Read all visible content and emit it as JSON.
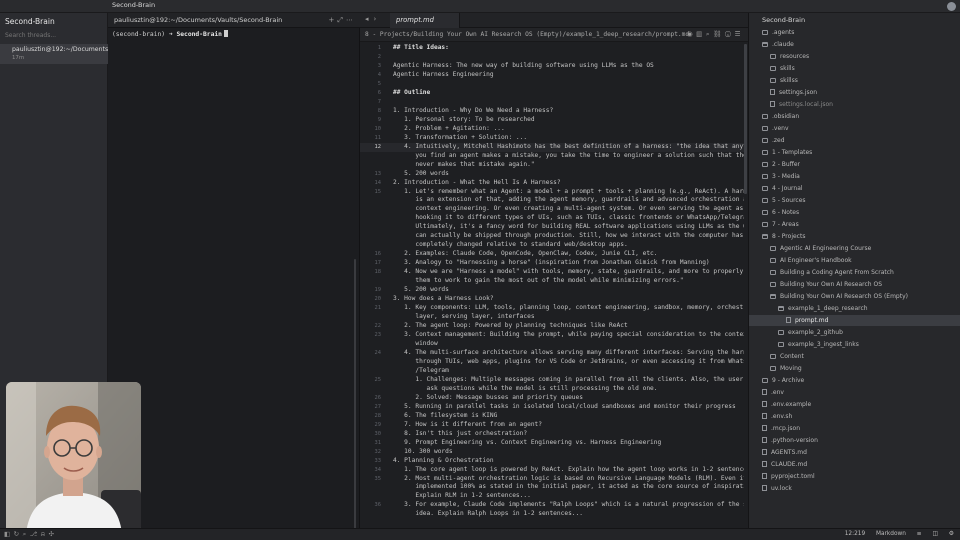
{
  "app": {
    "title": "Second-Brain"
  },
  "left_sidebar": {
    "vault_title": "Second-Brain",
    "search_placeholder": "Search threads...",
    "threads": [
      {
        "title": "pauliusztin@192:~/Documents/Vaults/Second-Brain",
        "time": "17m"
      }
    ]
  },
  "terminal": {
    "tab_title": "pauliusztin@192:~/Documents/Vaults/Second-Brain",
    "prompt_env": "(second-brain)",
    "prompt_arrow": "➜",
    "prompt_dir": "Second-Brain"
  },
  "editor": {
    "tab_label": "prompt.md",
    "path": "8 - Projects/Building Your Own AI Research OS (Empty)/example_1_deep_research/prompt.md",
    "active_line": "12",
    "lines": [
      {
        "n": "1",
        "t": "## Title Ideas:",
        "h": true
      },
      {
        "n": "2",
        "t": ""
      },
      {
        "n": "3",
        "t": "Agentic Harness: The new way of building software using LLMs as the OS"
      },
      {
        "n": "4",
        "t": "Agentic Harness Engineering"
      },
      {
        "n": "5",
        "t": ""
      },
      {
        "n": "6",
        "t": "## Outline",
        "h": true
      },
      {
        "n": "7",
        "t": ""
      },
      {
        "n": "8",
        "t": "1. Introduction - Why Do We Need a Harness?"
      },
      {
        "n": "9",
        "t": "   1. Personal story: To be researched"
      },
      {
        "n": "10",
        "t": "   2. Problem + Agitation: ..."
      },
      {
        "n": "11",
        "t": "   3. Transformation + Solution: ..."
      },
      {
        "n": "12",
        "t": "   4. Intuitively, Mitchell Hashimoto has the best definition of a harness: \"the idea that anytime"
      },
      {
        "n": "",
        "t": "      you find an agent makes a mistake, you take the time to engineer a solution such that the agent"
      },
      {
        "n": "",
        "t": "      never makes that mistake again.\""
      },
      {
        "n": "13",
        "t": "   5. 200 words"
      },
      {
        "n": "14",
        "t": "2. Introduction - What the Hell Is A Harness?"
      },
      {
        "n": "15",
        "t": "   1. Let's remember what an Agent: a model + a prompt + tools + planning (e.g., ReAct). A harness"
      },
      {
        "n": "",
        "t": "      is an extension of that, adding the agent memory, guardrails and advanced orchestration and"
      },
      {
        "n": "",
        "t": "      context engineering. Or even creating a multi-agent system. Or even serving the agent as a server"
      },
      {
        "n": "",
        "t": "      hooking it to different types of UIs, such as TUIs, classic frontends or WhatsApp/Telegram."
      },
      {
        "n": "",
        "t": "      Ultimately, it's a fancy word for building REAL software applications using LLMs as the OS that"
      },
      {
        "n": "",
        "t": "      can actually be shipped through production. Still, how we interact with the computer has"
      },
      {
        "n": "",
        "t": "      completely changed relative to standard web/desktop apps."
      },
      {
        "n": "16",
        "t": "   2. Examples: Claude Code, OpenCode, OpenClaw, Codex, Junie CLI, etc."
      },
      {
        "n": "17",
        "t": "   3. Analogy to \"Harnessing a horse\" (inspiration from Jonathan Gimick from Manning)"
      },
      {
        "n": "18",
        "t": "   4. Now we are \"Harness a model\" with tools, memory, state, guardrails, and more to properly \"put"
      },
      {
        "n": "",
        "t": "      them to work to gain the most out of the model while minimizing errors.\""
      },
      {
        "n": "19",
        "t": "   5. 200 words"
      },
      {
        "n": "20",
        "t": "3. How does a Harness Look?"
      },
      {
        "n": "21",
        "t": "   1. Key components: LLM, tools, planning loop, context engineering, sandbox, memory, orchestration"
      },
      {
        "n": "",
        "t": "      layer, serving layer, interfaces"
      },
      {
        "n": "22",
        "t": "   2. The agent loop: Powered by planning techniques like ReAct"
      },
      {
        "n": "23",
        "t": "   3. Context management: Building the prompt, while paying special consideration to the context"
      },
      {
        "n": "",
        "t": "      window"
      },
      {
        "n": "24",
        "t": "   4. The multi-surface architecture allows serving many different interfaces: Serving the harness"
      },
      {
        "n": "",
        "t": "      through TUIs, web apps, plugins for VS Code or JetBrains, or even accessing it from WhatsApp"
      },
      {
        "n": "",
        "t": "      /Telegram"
      },
      {
        "n": "25",
        "t": "      1. Challenges: Multiple messages coming in parallel from all the clients. Also, the user can"
      },
      {
        "n": "",
        "t": "         ask questions while the model is still processing the old one."
      },
      {
        "n": "26",
        "t": "      2. Solved: Message busses and priority queues"
      },
      {
        "n": "27",
        "t": "   5. Running in parallel tasks in isolated local/cloud sandboxes and monitor their progress"
      },
      {
        "n": "28",
        "t": "   6. The filesystem is KING"
      },
      {
        "n": "29",
        "t": "   7. How is it different from an agent?"
      },
      {
        "n": "30",
        "t": "   8. Isn't this just orchestration?"
      },
      {
        "n": "31",
        "t": "   9. Prompt Engineering vs. Context Engineering vs. Harness Engineering"
      },
      {
        "n": "32",
        "t": "   10. 300 words"
      },
      {
        "n": "33",
        "t": "4. Planning & Orchestration"
      },
      {
        "n": "34",
        "t": "   1. The core agent loop is powered by ReAct. Explain how the agent loop works in 1-2 sentences..."
      },
      {
        "n": "35",
        "t": "   2. Most multi-agent orchestration logic is based on Recursive Language Models (RLM). Even if not"
      },
      {
        "n": "",
        "t": "      implemented 100% as stated in the initial paper, it acted as the core source of inspiration."
      },
      {
        "n": "",
        "t": "      Explain RLM in 1-2 sentences..."
      },
      {
        "n": "36",
        "t": "   3. For example, Claude Code implements \"Ralph Loops\" which is a natural progression of the same"
      },
      {
        "n": "",
        "t": "      idea. Explain Ralph Loops in 1-2 sentences..."
      }
    ]
  },
  "file_tree": {
    "root": "Second-Brain",
    "items": [
      {
        "label": ".agents",
        "depth": 0,
        "kind": "folder"
      },
      {
        "label": ".claude",
        "depth": 0,
        "kind": "folder-open"
      },
      {
        "label": "resources",
        "depth": 1,
        "kind": "folder"
      },
      {
        "label": "skills",
        "depth": 1,
        "kind": "folder"
      },
      {
        "label": "skillss",
        "depth": 1,
        "kind": "folder"
      },
      {
        "label": "settings.json",
        "depth": 1,
        "kind": "file"
      },
      {
        "label": "settings.local.json",
        "depth": 1,
        "kind": "file",
        "dim": true
      },
      {
        "label": ".obsidian",
        "depth": 0,
        "kind": "folder"
      },
      {
        "label": ".venv",
        "depth": 0,
        "kind": "folder"
      },
      {
        "label": ".zed",
        "depth": 0,
        "kind": "folder"
      },
      {
        "label": "1 - Templates",
        "depth": 0,
        "kind": "folder"
      },
      {
        "label": "2 - Buffer",
        "depth": 0,
        "kind": "folder"
      },
      {
        "label": "3 - Media",
        "depth": 0,
        "kind": "folder"
      },
      {
        "label": "4 - Journal",
        "depth": 0,
        "kind": "folder"
      },
      {
        "label": "5 - Sources",
        "depth": 0,
        "kind": "folder"
      },
      {
        "label": "6 - Notes",
        "depth": 0,
        "kind": "folder"
      },
      {
        "label": "7 - Areas",
        "depth": 0,
        "kind": "folder"
      },
      {
        "label": "8 - Projects",
        "depth": 0,
        "kind": "folder-open"
      },
      {
        "label": "Agentic AI Engineering Course",
        "depth": 1,
        "kind": "folder"
      },
      {
        "label": "AI Engineer's Handbook",
        "depth": 1,
        "kind": "folder"
      },
      {
        "label": "Building a Coding Agent From Scratch",
        "depth": 1,
        "kind": "folder"
      },
      {
        "label": "Building Your Own AI Research OS",
        "depth": 1,
        "kind": "folder"
      },
      {
        "label": "Building Your Own AI Research OS (Empty)",
        "depth": 1,
        "kind": "folder-open"
      },
      {
        "label": "example_1_deep_research",
        "depth": 2,
        "kind": "folder-open"
      },
      {
        "label": "prompt.md",
        "depth": 3,
        "kind": "file",
        "selected": true
      },
      {
        "label": "example_2_github",
        "depth": 2,
        "kind": "folder"
      },
      {
        "label": "example_3_ingest_links",
        "depth": 2,
        "kind": "folder"
      },
      {
        "label": "Content",
        "depth": 1,
        "kind": "folder"
      },
      {
        "label": "Moving",
        "depth": 1,
        "kind": "folder"
      },
      {
        "label": "9 - Archive",
        "depth": 0,
        "kind": "folder"
      },
      {
        "label": ".env",
        "depth": 0,
        "kind": "file"
      },
      {
        "label": ".env.example",
        "depth": 0,
        "kind": "file"
      },
      {
        "label": ".env.sh",
        "depth": 0,
        "kind": "file"
      },
      {
        "label": ".mcp.json",
        "depth": 0,
        "kind": "file"
      },
      {
        "label": ".python-version",
        "depth": 0,
        "kind": "file"
      },
      {
        "label": "AGENTS.md",
        "depth": 0,
        "kind": "file"
      },
      {
        "label": "CLAUDE.md",
        "depth": 0,
        "kind": "file"
      },
      {
        "label": "pyproject.toml",
        "depth": 0,
        "kind": "file"
      },
      {
        "label": "uv.lock",
        "depth": 0,
        "kind": "file"
      }
    ]
  },
  "status_bar": {
    "cursor_pos": "12:219",
    "language": "Markdown"
  }
}
